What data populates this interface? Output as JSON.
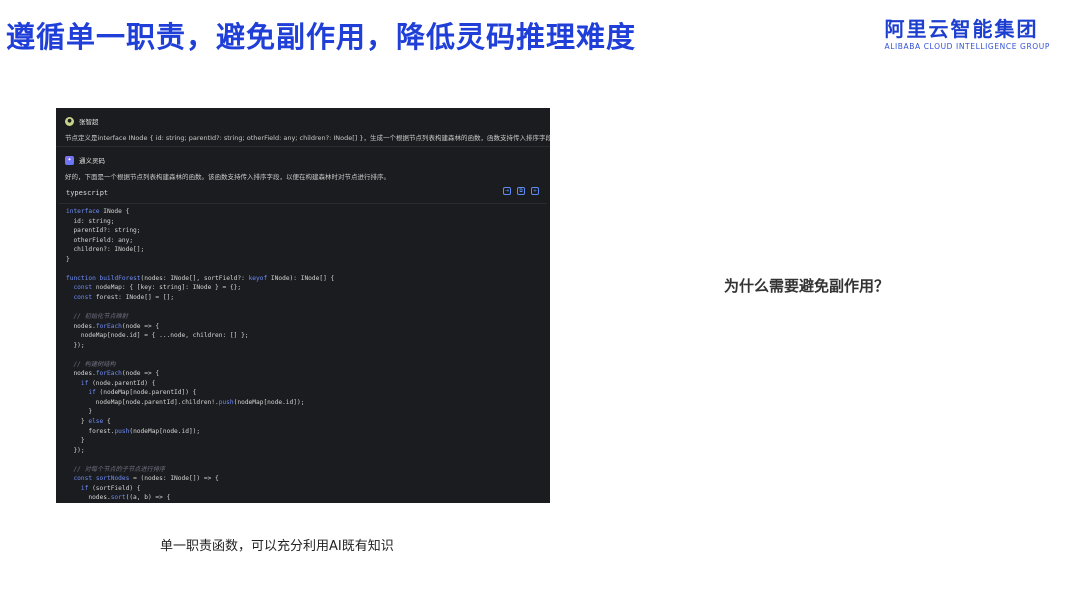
{
  "slide": {
    "title": "遵循单一职责，避免副作用，降低灵码推理难度",
    "logo_cn": "阿里云智能集团",
    "logo_en": "ALIBABA CLOUD INTELLIGENCE GROUP",
    "caption": "单一职责函数，可以充分利用AI既有知识",
    "question": "为什么需要避免副作用？"
  },
  "chat": {
    "user_name": "张智超",
    "user_message": "节点定义是interface INode { id: string; parentId?: string; otherField: any; children?: INode[] }，生成一个根据节点列表构建森林的函数，函数支持传入排序字段。",
    "ai_name": "通义灵码",
    "ai_message": "好的，下面是一个根据节点列表构建森林的函数。该函数支持传入排序字段，以便在构建森林时对节点进行排序。",
    "code_language": "typescript",
    "actions": [
      "insert-icon",
      "copy-icon",
      "new-file-icon"
    ],
    "code_lines": [
      {
        "text": "interface INode {",
        "kind": "code"
      },
      {
        "text": "  id: string;",
        "kind": "code"
      },
      {
        "text": "  parentId?: string;",
        "kind": "code"
      },
      {
        "text": "  otherField: any;",
        "kind": "code"
      },
      {
        "text": "  children?: INode[];",
        "kind": "code"
      },
      {
        "text": "}",
        "kind": "code"
      },
      {
        "text": "",
        "kind": "code"
      },
      {
        "text": "function buildForest(nodes: INode[], sortField?: keyof INode): INode[] {",
        "kind": "code"
      },
      {
        "text": "  const nodeMap: { [key: string]: INode } = {};",
        "kind": "code"
      },
      {
        "text": "  const forest: INode[] = [];",
        "kind": "code"
      },
      {
        "text": "",
        "kind": "code"
      },
      {
        "text": "  // 初始化节点映射",
        "kind": "comment"
      },
      {
        "text": "  nodes.forEach(node => {",
        "kind": "code"
      },
      {
        "text": "    nodeMap[node.id] = { ...node, children: [] };",
        "kind": "code"
      },
      {
        "text": "  });",
        "kind": "code"
      },
      {
        "text": "",
        "kind": "code"
      },
      {
        "text": "  // 构建树结构",
        "kind": "comment"
      },
      {
        "text": "  nodes.forEach(node => {",
        "kind": "code"
      },
      {
        "text": "    if (node.parentId) {",
        "kind": "code"
      },
      {
        "text": "      if (nodeMap[node.parentId]) {",
        "kind": "code"
      },
      {
        "text": "        nodeMap[node.parentId].children!.push(nodeMap[node.id]);",
        "kind": "code"
      },
      {
        "text": "      }",
        "kind": "code"
      },
      {
        "text": "    } else {",
        "kind": "code"
      },
      {
        "text": "      forest.push(nodeMap[node.id]);",
        "kind": "code"
      },
      {
        "text": "    }",
        "kind": "code"
      },
      {
        "text": "  });",
        "kind": "code"
      },
      {
        "text": "",
        "kind": "code"
      },
      {
        "text": "  // 对每个节点的子节点进行排序",
        "kind": "comment"
      },
      {
        "text": "  const sortNodes = (nodes: INode[]) => {",
        "kind": "code"
      },
      {
        "text": "    if (sortField) {",
        "kind": "code"
      },
      {
        "text": "      nodes.sort((a, b) => {",
        "kind": "code"
      }
    ]
  }
}
